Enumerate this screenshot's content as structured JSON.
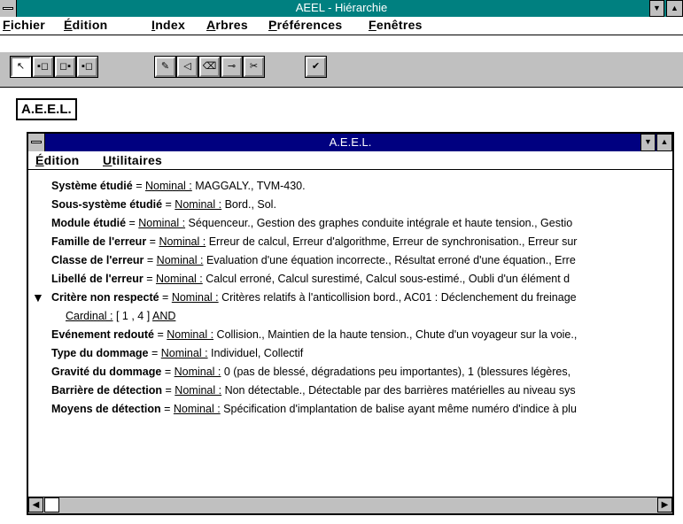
{
  "window": {
    "title": "AEEL - Hiérarchie"
  },
  "menubar": [
    {
      "u": "F",
      "rest": "ichier"
    },
    {
      "u": "É",
      "rest": "dition"
    },
    {
      "u": "I",
      "rest": "ndex"
    },
    {
      "u": "A",
      "rest": "rbres"
    },
    {
      "u": "P",
      "rest": "références"
    },
    {
      "u": "F",
      "rest": "enêtres"
    }
  ],
  "toolbar": {
    "icons": [
      "arrow-pointer-icon",
      "node-left-icon",
      "node-center-icon",
      "node-right-icon",
      "pencil-icon",
      "left-arrow-icon",
      "eraser-icon",
      "link-icon",
      "scissors-icon",
      "checkmark-icon"
    ],
    "glyphs": [
      "↖",
      "▪◻",
      "◻▪",
      "▪◻",
      "✎",
      "◁",
      "⌫",
      "⊸",
      "✂",
      "✔"
    ]
  },
  "root_label": "A.E.E.L.",
  "inner": {
    "title": "A.E.E.L.",
    "menu": [
      {
        "u": "É",
        "rest": "dition"
      },
      {
        "u": "U",
        "rest": "tilitaires"
      }
    ],
    "lines": [
      {
        "label": "Système étudié",
        "nom": "Nominal :",
        "text": " MAGGALY., TVM-430."
      },
      {
        "label": "Sous-système étudié",
        "nom": "Nominal :",
        "text": " Bord., Sol."
      },
      {
        "label": "Module étudié",
        "nom": "Nominal :",
        "text": " Séquenceur., Gestion des graphes conduite intégrale et haute tension., Gestio"
      },
      {
        "label": "Famille de l'erreur",
        "nom": "Nominal :",
        "text": " Erreur de calcul, Erreur d'algorithme, Erreur de synchronisation., Erreur sur"
      },
      {
        "label": "Classe de l'erreur",
        "nom": "Nominal :",
        "text": " Evaluation d'une équation incorrecte., Résultat erroné d'une équation., Erre"
      },
      {
        "label": "Libellé de l'erreur",
        "nom": "Nominal :",
        "text": " Calcul erroné, Calcul surestimé, Calcul sous-estimé., Oubli d'un élément d"
      },
      {
        "label": "Critère non respecté",
        "nom": "Nominal :",
        "text": " Critères relatifs à l'anticollision bord., AC01 : Déclenchement du freinage"
      },
      {
        "label": "",
        "nom": "Cardinal :",
        "text": " [ 1 , 4 ] ",
        "extra": "AND"
      },
      {
        "label": "Evénement redouté",
        "nom": "Nominal :",
        "text": " Collision., Maintien de la haute tension., Chute d'un voyageur sur la voie.,"
      },
      {
        "label": "Type du dommage",
        "nom": "Nominal :",
        "text": " Individuel, Collectif"
      },
      {
        "label": "Gravité du dommage",
        "nom": "Nominal :",
        "text": " 0 (pas de blessé, dégradations peu importantes), 1 (blessures légères,"
      },
      {
        "label": "Barrière de détection",
        "nom": "Nominal :",
        "text": " Non détectable., Détectable par des barrières matérielles au niveau sys"
      },
      {
        "label": "Moyens de détection",
        "nom": "Nominal :",
        "text": " Spécification d'implantation de balise ayant même numéro d'indice à plu"
      }
    ]
  }
}
